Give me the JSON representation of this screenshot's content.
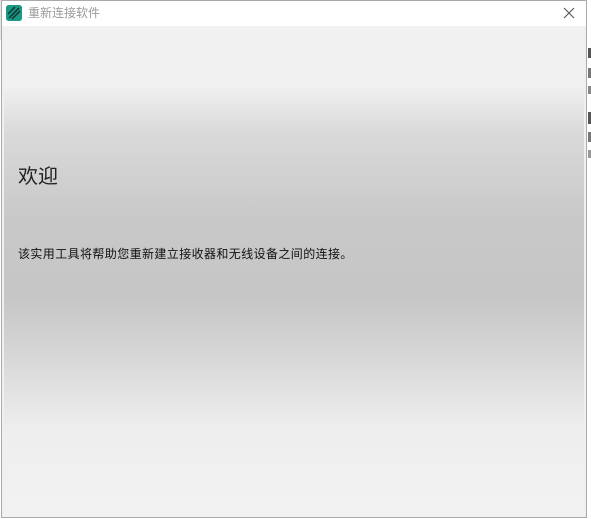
{
  "window": {
    "title": "重新连接软件",
    "close_icon": "close-icon",
    "app_icon": "app-logo-icon"
  },
  "content": {
    "heading": "欢迎",
    "description": "该实用工具将帮助您重新建立接收器和无线设备之间的连接。"
  },
  "colors": {
    "app_icon_bg": "#1a9a86",
    "title_text": "#9a9a9a",
    "gradient_mid": "#c6c6c6",
    "gradient_edge": "#f1f1f1"
  }
}
